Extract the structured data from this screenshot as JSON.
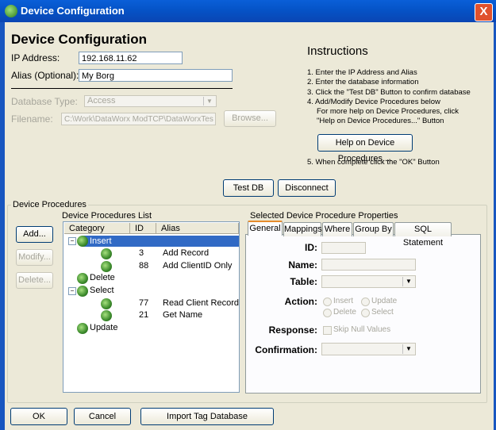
{
  "window": {
    "title": "Device Configuration",
    "close_glyph": "X"
  },
  "header": {
    "title": "Device Configuration"
  },
  "fields": {
    "ip_label": "IP Address:",
    "ip_value": "192.168.11.62",
    "alias_label": "Alias (Optional):",
    "alias_value": "My Borg",
    "dbtype_label": "Database Type:",
    "dbtype_value": "Access",
    "filename_label": "Filename:",
    "filename_value": "C:\\Work\\DataWorx ModTCP\\DataWorxTes",
    "browse_label": "Browse..."
  },
  "instructions": {
    "title": "Instructions",
    "step1": "1. Enter the IP Address and Alias",
    "step2": "2. Enter the database information",
    "step3": "3. Click the \"Test DB\" Button to confirm database",
    "step4": "4. Add/Modify Device Procedures below",
    "step4a": "For more help on Device Procedures, click",
    "step4b": "\"Help on Device Procedures...\" Button",
    "help_button": "Help on Device Procedures....",
    "step5": "5. When complete click the \"OK\" Button"
  },
  "db_buttons": {
    "test": "Test DB",
    "disconnect": "Disconnect"
  },
  "procedures": {
    "group_label": "Device Procedures",
    "list_label": "Device Procedures List",
    "add": "Add...",
    "modify": "Modify...",
    "delete": "Delete...",
    "columns": {
      "category": "Category",
      "id": "ID",
      "alias": "Alias"
    },
    "tree": {
      "insert": "Insert",
      "delete": "Delete",
      "select": "Select",
      "update": "Update",
      "rows": [
        {
          "id": "3",
          "alias": "Add Record"
        },
        {
          "id": "88",
          "alias": "Add ClientID Only"
        },
        {
          "id": "77",
          "alias": "Read Client Record"
        },
        {
          "id": "21",
          "alias": "Get Name"
        }
      ]
    }
  },
  "properties": {
    "title": "Selected Device Procedure Properties",
    "tabs": [
      "General",
      "Mappings",
      "Where",
      "Group By",
      "SQL Statement"
    ],
    "id_label": "ID:",
    "name_label": "Name:",
    "table_label": "Table:",
    "action_label": "Action:",
    "actions": {
      "insert": "Insert",
      "update": "Update",
      "delete": "Delete",
      "select": "Select"
    },
    "response_label": "Response:",
    "skip_null": "Skip Null Values",
    "confirmation_label": "Confirmation:"
  },
  "footer": {
    "ok": "OK",
    "cancel": "Cancel",
    "import": "Import Tag Database"
  }
}
